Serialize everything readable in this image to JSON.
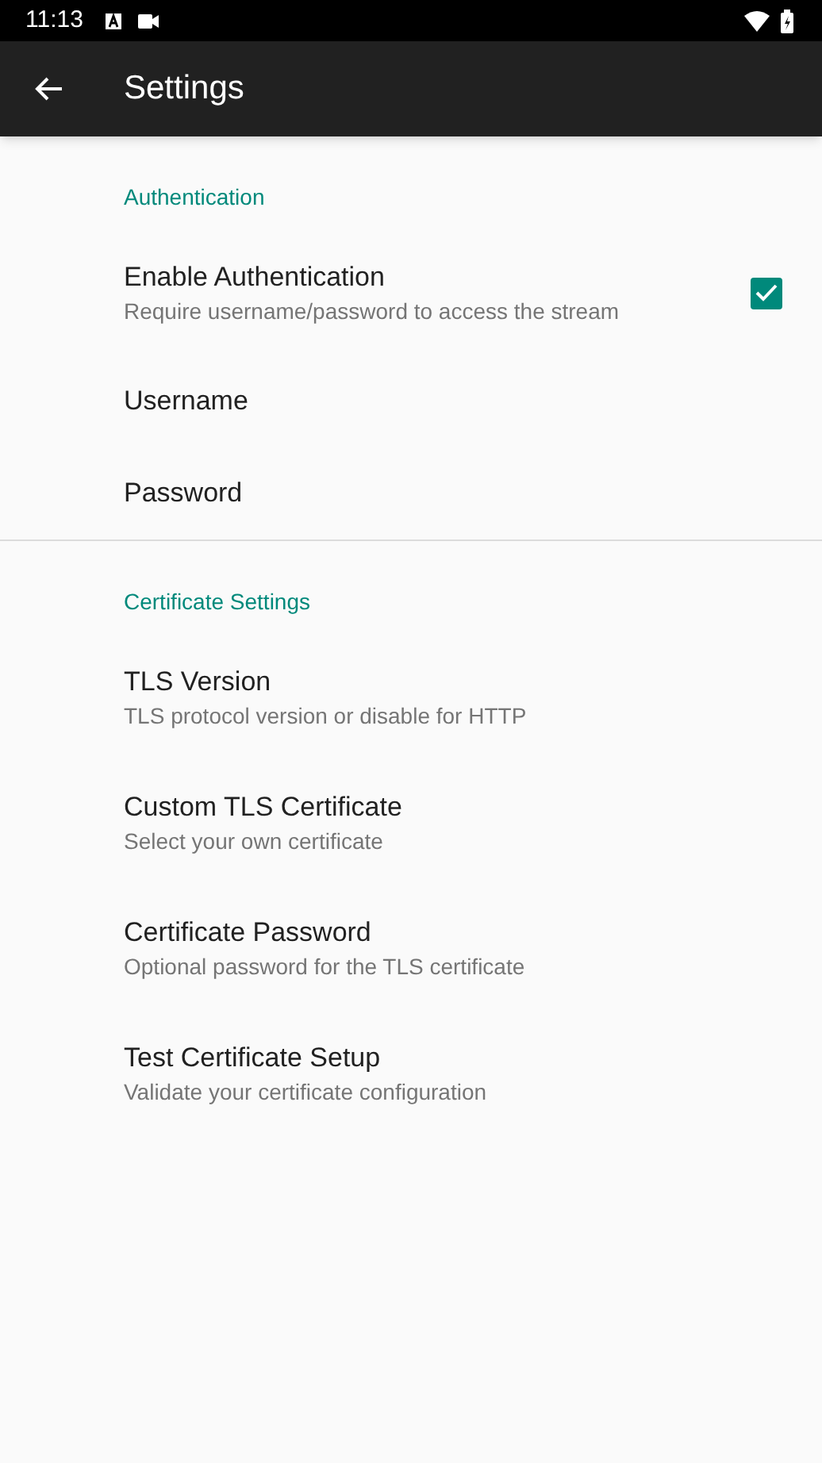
{
  "status_bar": {
    "time": "11:13"
  },
  "app_bar": {
    "title": "Settings"
  },
  "sections": [
    {
      "title": "Authentication",
      "items": [
        {
          "kind": "checkbox",
          "title": "Enable Authentication",
          "summary": "Require username/password to access the stream",
          "checked": true
        },
        {
          "kind": "plain",
          "title": "Username"
        },
        {
          "kind": "plain",
          "title": "Password"
        }
      ]
    },
    {
      "title": "Certificate Settings",
      "items": [
        {
          "kind": "plain",
          "title": "TLS Version",
          "summary": "TLS protocol version or disable for HTTP"
        },
        {
          "kind": "plain",
          "title": "Custom TLS Certificate",
          "summary": "Select your own certificate"
        },
        {
          "kind": "plain",
          "title": "Certificate Password",
          "summary": "Optional password for the TLS certificate"
        },
        {
          "kind": "plain",
          "title": "Test Certificate Setup",
          "summary": "Validate your certificate configuration"
        }
      ]
    }
  ]
}
